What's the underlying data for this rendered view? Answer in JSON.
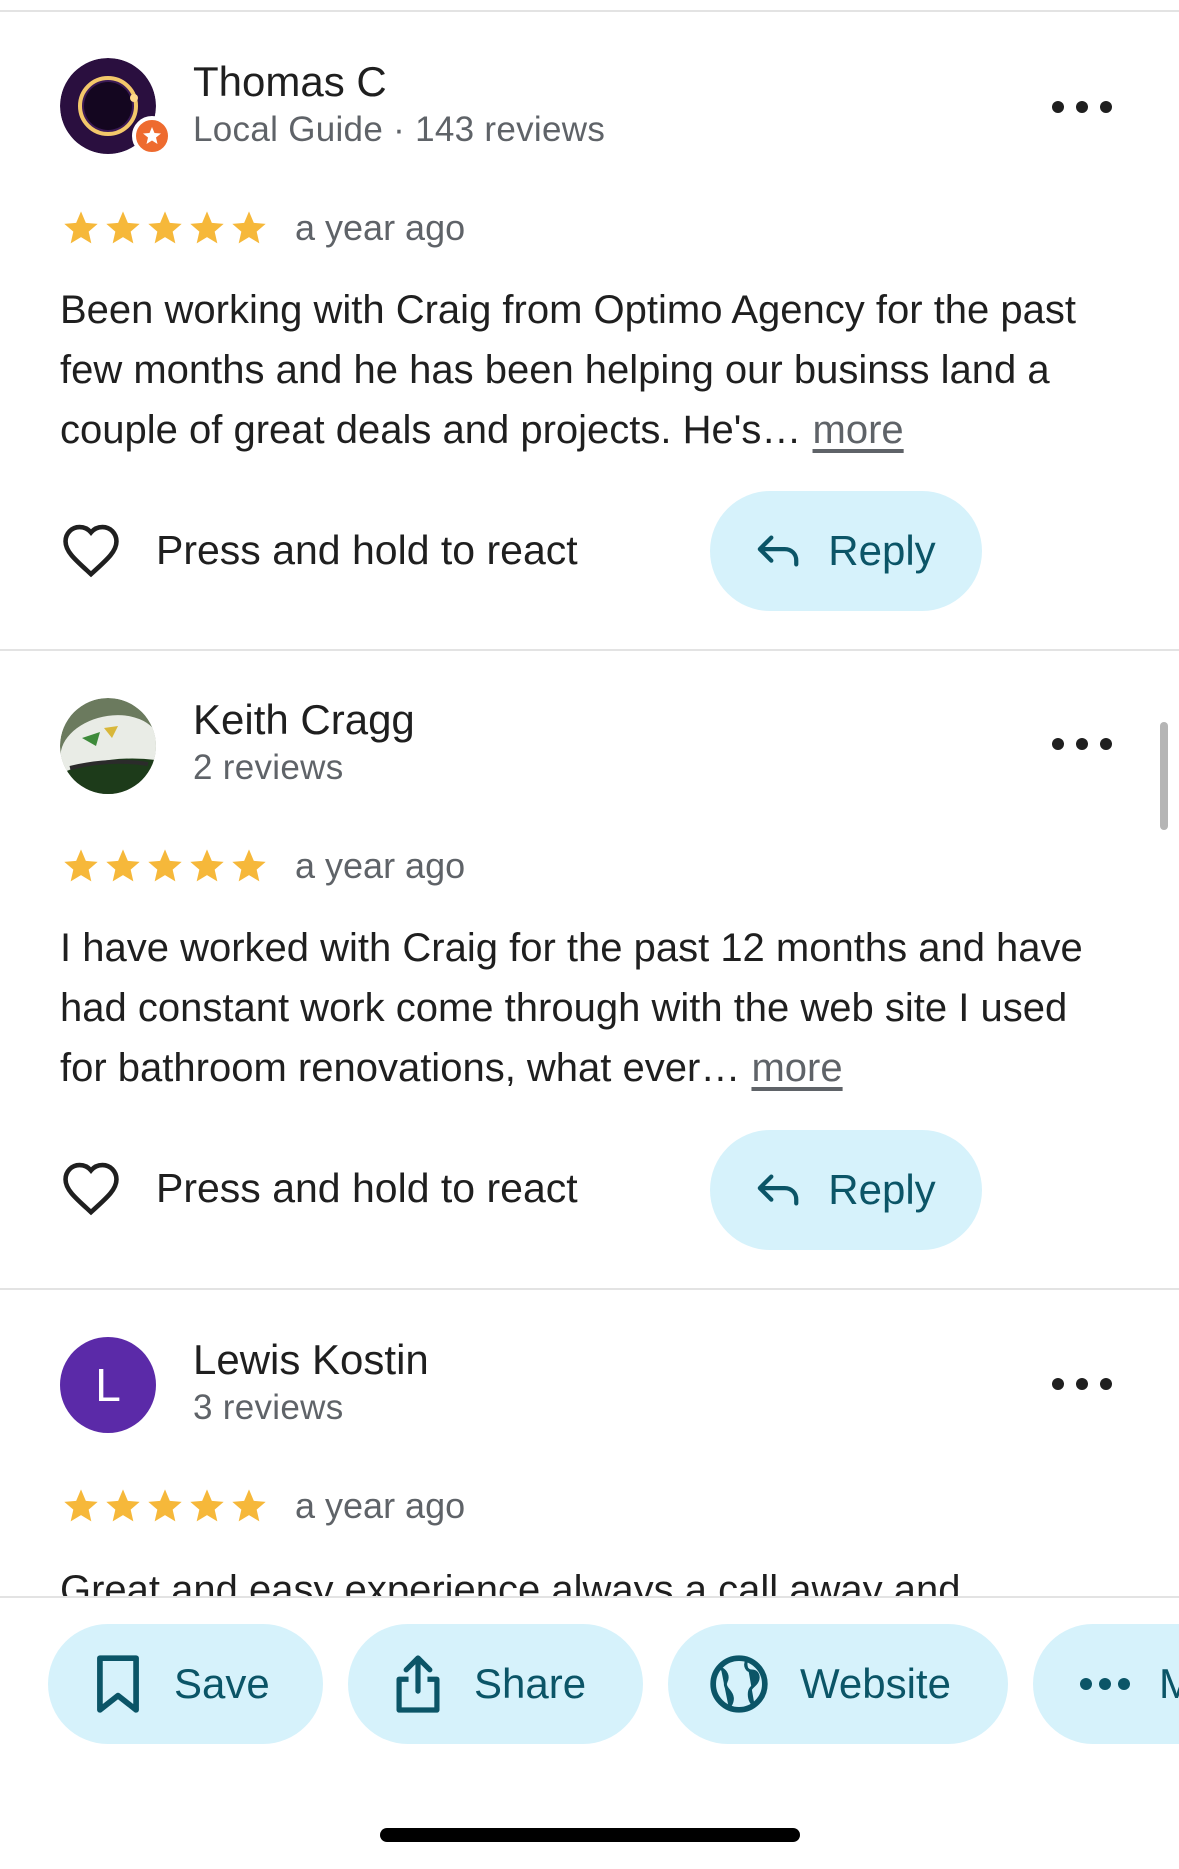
{
  "reviews": [
    {
      "name": "Thomas C",
      "meta": "Local Guide · 143 reviews",
      "rating": 5,
      "time": "a year ago",
      "text": "Been working with Craig from Optimo Agency for the past few months and he has been helping our businss land a couple of great deals and projects. He's…",
      "more": "more",
      "react_label": "Press and hold to react",
      "reply_label": "Reply",
      "avatar": "eclipse-photo"
    },
    {
      "name": "Keith Cragg",
      "meta": "2 reviews",
      "rating": 5,
      "time": "a year ago",
      "text": "I have worked with Craig for the past 12 months and have had constant work come through with the web site I used for bathroom renovations, what ever…",
      "more": "more",
      "react_label": "Press and hold to react",
      "reply_label": "Reply",
      "avatar": "rugby-ball-photo"
    },
    {
      "name": "Lewis Kostin",
      "meta": "3 reviews",
      "rating": 5,
      "time": "a year ago",
      "text": "Great and easy experience always a call away and",
      "avatar_letter": "L",
      "avatar_color": "#5b2aa8"
    }
  ],
  "actions": [
    {
      "label": "Save",
      "icon": "bookmark-icon"
    },
    {
      "label": "Share",
      "icon": "share-icon"
    },
    {
      "label": "Website",
      "icon": "globe-icon"
    },
    {
      "label": "M",
      "icon": "more-horiz-icon"
    }
  ],
  "colors": {
    "star": "#f6b83a",
    "chip_bg": "#d6f2fb",
    "chip_text": "#0b5567",
    "badge": "#ee6b2f"
  }
}
